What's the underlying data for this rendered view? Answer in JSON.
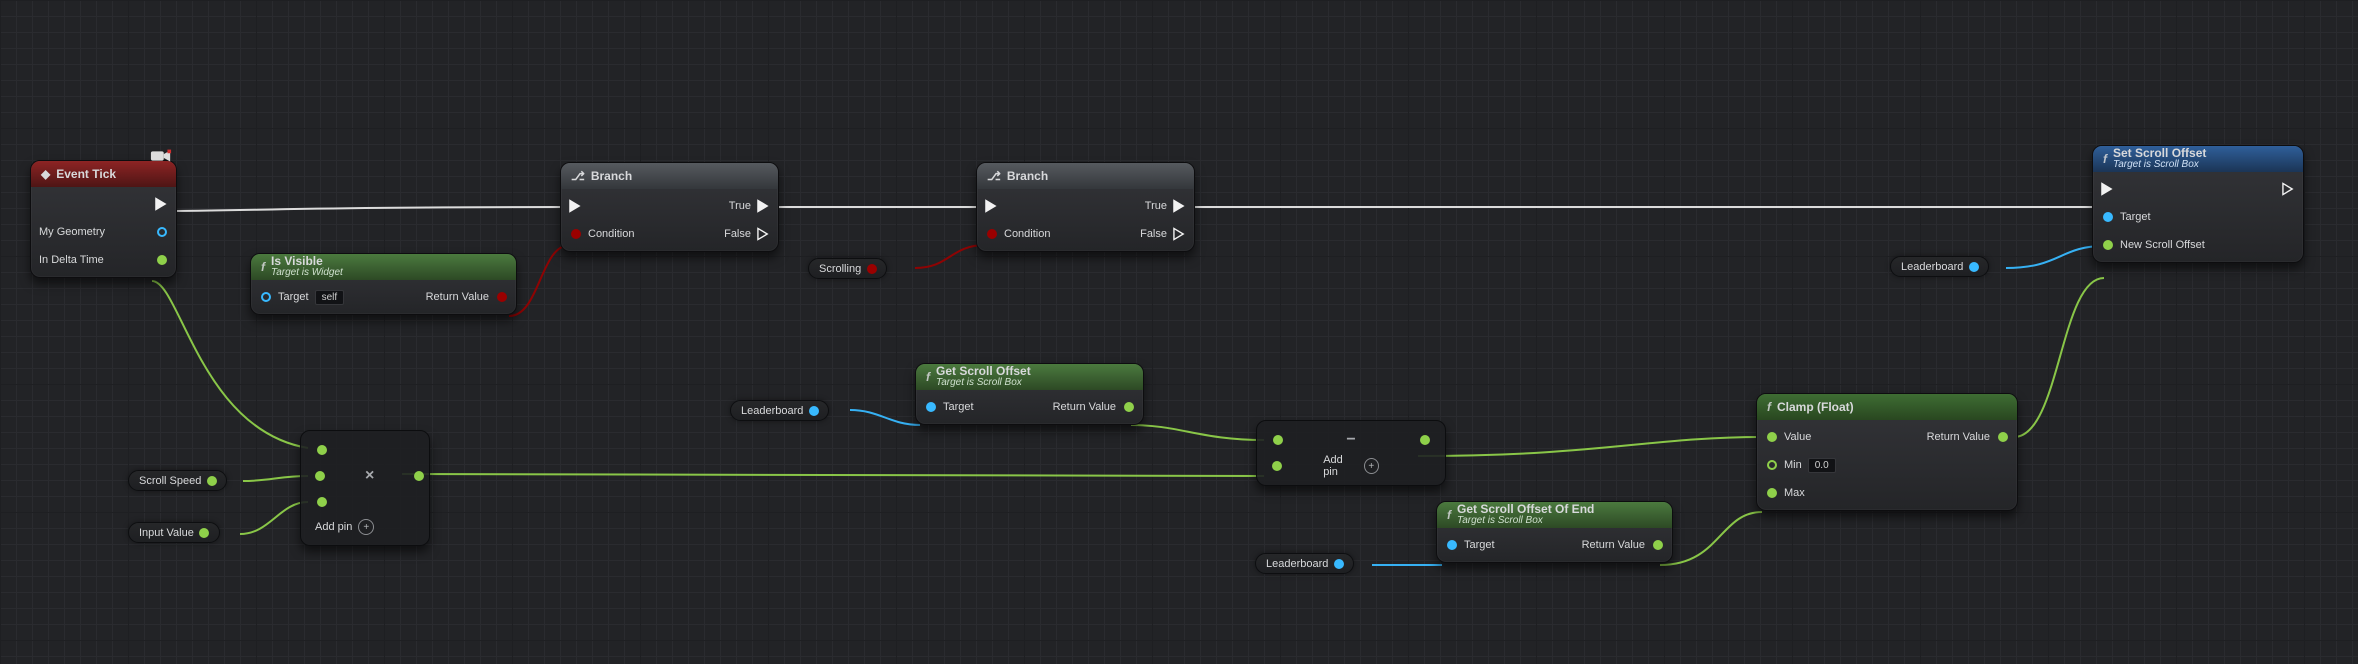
{
  "nodes": {
    "event_tick": {
      "title": "Event Tick",
      "pins": {
        "my_geometry": "My Geometry",
        "in_delta": "In Delta Time"
      }
    },
    "is_visible": {
      "title": "Is Visible",
      "sub": "Target is Widget",
      "pins": {
        "target": "Target",
        "target_default": "self",
        "return": "Return Value"
      }
    },
    "branch1": {
      "title": "Branch",
      "pins": {
        "condition": "Condition",
        "true": "True",
        "false": "False"
      }
    },
    "branch2": {
      "title": "Branch",
      "pins": {
        "condition": "Condition",
        "true": "True",
        "false": "False"
      }
    },
    "get_scroll": {
      "title": "Get Scroll Offset",
      "sub": "Target is Scroll Box",
      "pins": {
        "target": "Target",
        "return": "Return Value"
      }
    },
    "get_scroll_end": {
      "title": "Get Scroll Offset Of End",
      "sub": "Target is Scroll Box",
      "pins": {
        "target": "Target",
        "return": "Return Value"
      }
    },
    "clamp": {
      "title": "Clamp (Float)",
      "pins": {
        "value": "Value",
        "min": "Min",
        "min_default": "0.0",
        "max": "Max",
        "return": "Return Value"
      }
    },
    "set_scroll": {
      "title": "Set Scroll Offset",
      "sub": "Target is Scroll Box",
      "pins": {
        "target": "Target",
        "new_offset": "New Scroll Offset"
      }
    },
    "multiply": {
      "op": "×",
      "add_pin": "Add pin"
    },
    "subtract": {
      "op": "−",
      "add_pin": "Add pin"
    }
  },
  "chips": {
    "scrolling": "Scrolling",
    "leaderboard": "Leaderboard",
    "scroll_speed": "Scroll Speed",
    "input_value": "Input Value"
  },
  "icons": {
    "event": "event-icon",
    "branch": "branch-icon",
    "func": "function-icon",
    "camera": "camera-icon"
  }
}
